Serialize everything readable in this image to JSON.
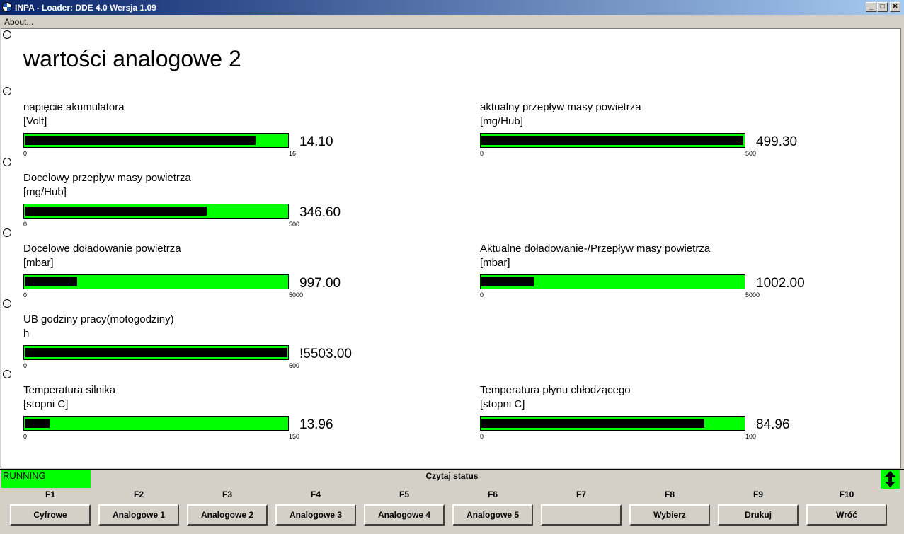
{
  "window": {
    "title": "INPA - Loader:  DDE 4.0 Wersja 1.09",
    "min_glyph": "_",
    "max_glyph": "□",
    "close_glyph": "✕"
  },
  "menu": {
    "about": "About..."
  },
  "page": {
    "title": "wartości analogowe 2"
  },
  "gauges": [
    {
      "label": "napięcie akumulatora",
      "unit": "[Volt]",
      "min": "0",
      "max": "16",
      "value": "14.10",
      "fill": 0.88
    },
    {
      "label": "aktualny przepływ masy powietrza",
      "unit": "[mg/Hub]",
      "min": "0",
      "max": "500",
      "value": "499.30",
      "fill": 0.998
    },
    {
      "label": "Docelowy przepływ masy powietrza",
      "unit": "[mg/Hub]",
      "min": "0",
      "max": "500",
      "value": "346.60",
      "fill": 0.693
    },
    {
      "label": "Docelowe doładowanie powietrza",
      "unit": "[mbar]",
      "min": "0",
      "max": "5000",
      "value": "997.00",
      "fill": 0.199
    },
    {
      "label": "Aktualne doładowanie-/Przepływ masy powietrza",
      "unit": "[mbar]",
      "min": "0",
      "max": "5000",
      "value": "1002.00",
      "fill": 0.2
    },
    {
      "label": "UB godziny pracy(motogodziny)",
      "unit": "h",
      "min": "0",
      "max": "500",
      "value": "!5503.00",
      "fill": 1.0
    },
    {
      "label": "Temperatura silnika",
      "unit": "[stopni C]",
      "min": "0",
      "max": "150",
      "value": "13.96",
      "fill": 0.093
    },
    {
      "label": "Temperatura płynu chłodzącego",
      "unit": "[stopni C]",
      "min": "0",
      "max": "100",
      "value": "84.96",
      "fill": 0.85
    }
  ],
  "status": {
    "running": "RUNNING",
    "text": "Czytaj status"
  },
  "fkeys": [
    {
      "key": "F1",
      "label": "Cyfrowe"
    },
    {
      "key": "F2",
      "label": "Analogowe 1"
    },
    {
      "key": "F3",
      "label": "Analogowe 2"
    },
    {
      "key": "F4",
      "label": "Analogowe 3"
    },
    {
      "key": "F5",
      "label": "Analogowe 4"
    },
    {
      "key": "F6",
      "label": "Analogowe 5"
    },
    {
      "key": "F7",
      "label": ""
    },
    {
      "key": "F8",
      "label": "Wybierz"
    },
    {
      "key": "F9",
      "label": "Drukuj"
    },
    {
      "key": "F10",
      "label": "Wróć"
    }
  ],
  "colors": {
    "bar_track": "#00ff00",
    "bar_fill": "#000000",
    "running": "#00ff00"
  }
}
